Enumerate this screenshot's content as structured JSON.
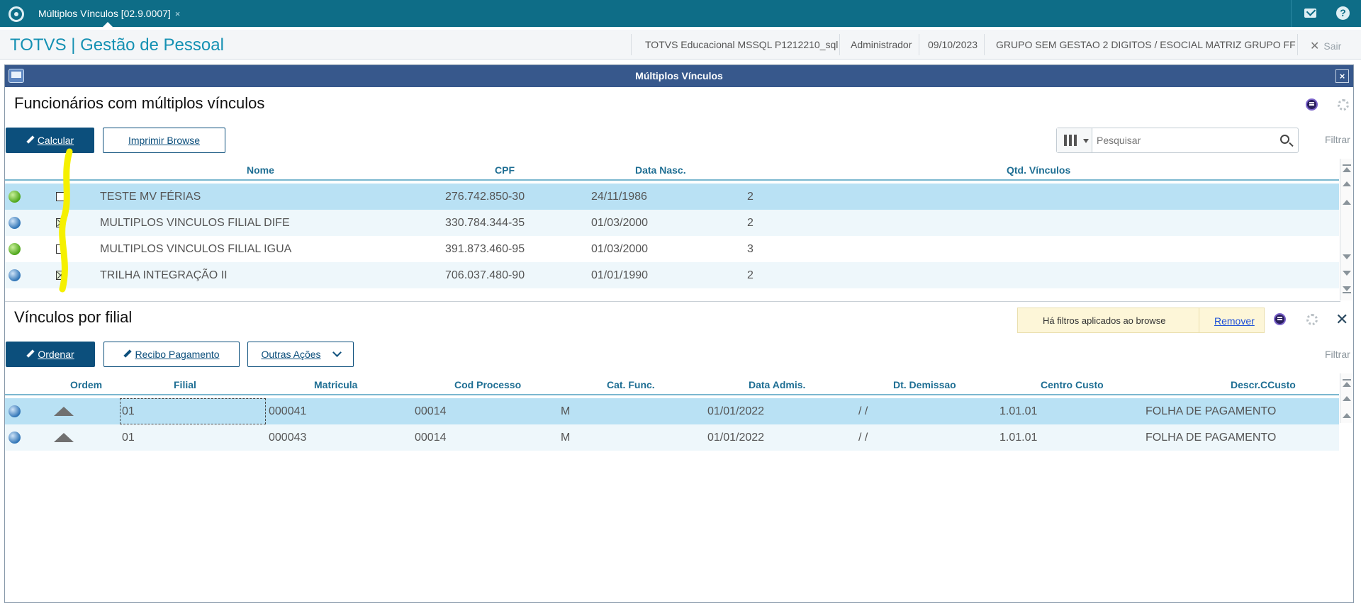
{
  "tabbar": {
    "tab_title": "Múltiplos Vínculos [02.9.0007]",
    "tab_close": "×"
  },
  "header": {
    "app_title": "TOTVS | Gestão de Pessoal",
    "environment": "TOTVS Educacional MSSQL P1212210_sql",
    "user": "Administrador",
    "date": "09/10/2023",
    "company": "GRUPO SEM GESTAO 2 DIGITOS / ESOCIAL MATRIZ GRUPO FF",
    "exit_label": "Sair"
  },
  "window": {
    "title": "Múltiplos Vínculos"
  },
  "top_section": {
    "title": "Funcionários com múltiplos vínculos",
    "calcular_label": "Calcular",
    "imprimir_label": "Imprimir Browse",
    "search_placeholder": "Pesquisar",
    "filtrar_label": "Filtrar",
    "columns": {
      "nome": "Nome",
      "cpf": "CPF",
      "data_nasc": "Data Nasc.",
      "qtd_vinculos": "Qtd. Vínculos"
    },
    "rows": [
      {
        "status": "green",
        "checked": false,
        "nome": "TESTE MV FÉRIAS",
        "cpf": "276.742.850-30",
        "data_nasc": "24/11/1986",
        "qtd": "2"
      },
      {
        "status": "blue",
        "checked": true,
        "nome": "MULTIPLOS VINCULOS FILIAL DIFE",
        "cpf": "330.784.344-35",
        "data_nasc": "01/03/2000",
        "qtd": "2"
      },
      {
        "status": "green",
        "checked": false,
        "nome": "MULTIPLOS VINCULOS FILIAL IGUA",
        "cpf": "391.873.460-95",
        "data_nasc": "01/03/2000",
        "qtd": "3"
      },
      {
        "status": "blue",
        "checked": true,
        "nome": "TRILHA INTEGRAÇÃO II",
        "cpf": "706.037.480-90",
        "data_nasc": "01/01/1990",
        "qtd": "2"
      }
    ]
  },
  "bottom_section": {
    "title": "Vínculos por filial",
    "filter_notice": "Há filtros aplicados ao browse",
    "remover_label": "Remover",
    "ordenar_label": "Ordenar",
    "recibo_label": "Recibo Pagamento",
    "outras_label": "Outras Ações",
    "filtrar_label": "Filtrar",
    "columns": {
      "ordem": "Ordem",
      "filial": "Filial",
      "matricula": "Matricula",
      "cod_processo": "Cod Processo",
      "cat_func": "Cat. Func.",
      "data_admis": "Data Admis.",
      "dt_demissao": "Dt. Demissao",
      "centro_custo": "Centro Custo",
      "descr_ccusto": "Descr.CCusto"
    },
    "rows": [
      {
        "filial": "01",
        "matricula": "000041",
        "cod_processo": "00014",
        "cat_func": "M",
        "data_admis": "01/01/2022",
        "dt_demissao": "/ /",
        "centro_custo": "1.01.01",
        "descr_ccusto": "FOLHA DE PAGAMENTO"
      },
      {
        "filial": "01",
        "matricula": "000043",
        "cod_processo": "00014",
        "cat_func": "M",
        "data_admis": "01/01/2022",
        "dt_demissao": "/ /",
        "centro_custo": "1.01.01",
        "descr_ccusto": "FOLHA DE PAGAMENTO"
      }
    ]
  },
  "colors": {
    "topbar": "#0e6d87",
    "title_bar": "#37588c",
    "primary_button": "#0c4f7c",
    "selected_row": "#b9e1f4",
    "highlight_marker": "#f5f000"
  },
  "icons": [
    "totvs-logo-icon",
    "mail-icon",
    "help-icon",
    "window-icon",
    "pencil-icon",
    "columns-icon",
    "search-icon",
    "gear-icon",
    "badge-icon",
    "close-icon",
    "status-led-icon",
    "sort-up-icon"
  ]
}
